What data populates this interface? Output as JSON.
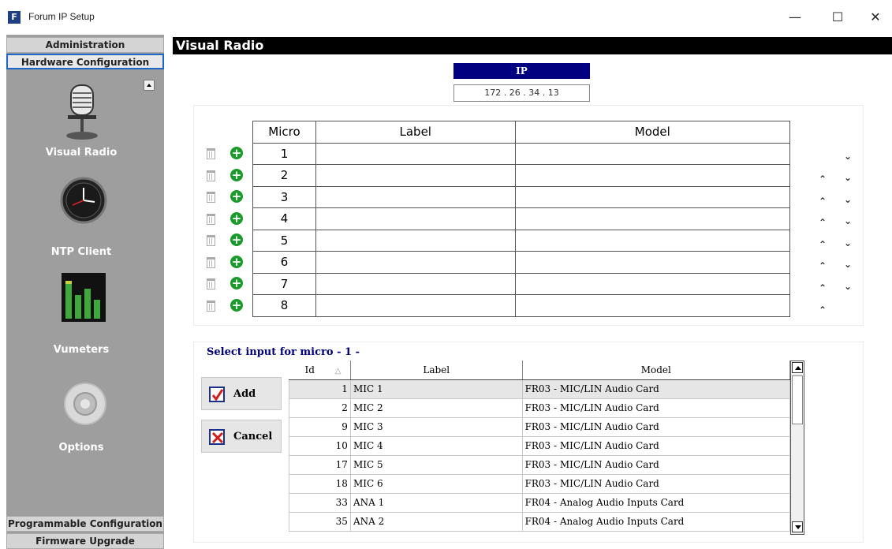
{
  "window": {
    "title": "Forum IP Setup",
    "icon_letter": "F",
    "minimize": "—",
    "maximize": "☐",
    "close": "✕"
  },
  "sidebar": {
    "top_sections": [
      "Administration",
      "Hardware Configuration"
    ],
    "items": [
      {
        "label": "Visual Radio",
        "icon": "microphone-icon"
      },
      {
        "label": "NTP Client",
        "icon": "clock-icon"
      },
      {
        "label": "Vumeters",
        "icon": "vumeter-icon"
      },
      {
        "label": "Options",
        "icon": "gear-icon"
      }
    ],
    "bottom_sections": [
      "Programmable Configuration",
      "Firmware Upgrade"
    ]
  },
  "main": {
    "title": "Visual Radio",
    "ip_label": "IP",
    "ip_value": "172 . 26 . 34 . 13",
    "micro_table": {
      "headers": [
        "Micro",
        "Label",
        "Model"
      ],
      "rows": [
        {
          "micro": "1",
          "label": "",
          "model": ""
        },
        {
          "micro": "2",
          "label": "",
          "model": ""
        },
        {
          "micro": "3",
          "label": "",
          "model": ""
        },
        {
          "micro": "4",
          "label": "",
          "model": ""
        },
        {
          "micro": "5",
          "label": "",
          "model": ""
        },
        {
          "micro": "6",
          "label": "",
          "model": ""
        },
        {
          "micro": "7",
          "label": "",
          "model": ""
        },
        {
          "micro": "8",
          "label": "",
          "model": ""
        }
      ]
    },
    "select_label": "Select input for micro - 1 -",
    "add_label": "Add",
    "cancel_label": "Cancel",
    "input_table": {
      "headers": [
        "Id",
        "Label",
        "Model"
      ],
      "sort_indicator": "△",
      "rows": [
        {
          "id": "1",
          "label": "MIC 1",
          "model": "FR03 - MIC/LIN Audio Card"
        },
        {
          "id": "2",
          "label": "MIC 2",
          "model": "FR03 - MIC/LIN Audio Card"
        },
        {
          "id": "9",
          "label": "MIC 3",
          "model": "FR03 - MIC/LIN Audio Card"
        },
        {
          "id": "10",
          "label": "MIC 4",
          "model": "FR03 - MIC/LIN Audio Card"
        },
        {
          "id": "17",
          "label": "MIC 5",
          "model": "FR03 - MIC/LIN Audio Card"
        },
        {
          "id": "18",
          "label": "MIC 6",
          "model": "FR03 - MIC/LIN Audio Card"
        },
        {
          "id": "33",
          "label": "ANA 1",
          "model": "FR04 - Analog Audio Inputs Card"
        },
        {
          "id": "35",
          "label": "ANA 2",
          "model": "FR04 - Analog Audio Inputs Card"
        }
      ]
    }
  }
}
